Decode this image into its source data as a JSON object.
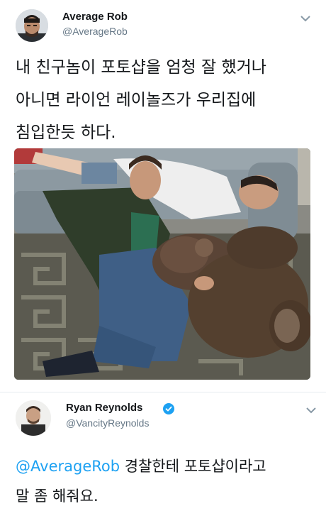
{
  "tweet1": {
    "author_name": "Average Rob",
    "author_handle": "@AverageRob",
    "lines": [
      "내 친구놈이 포토샵을 엄청 잘 했거나",
      "아니면 라이언 레이놀즈가 우리집에",
      "침입한듯 하다."
    ]
  },
  "tweet2": {
    "author_name": "Ryan Reynolds",
    "author_handle": "@VancityReynolds",
    "mention": "@AverageRob",
    "line1_rest": " 경찰한테 포토샵이라고",
    "line2": "말 좀 해줘요."
  },
  "colors": {
    "accent": "#1da1f2",
    "text": "#14171a",
    "secondary": "#657786"
  },
  "icons": {
    "dropdown": "chevron-down-icon",
    "verified": "verified-badge-icon"
  }
}
